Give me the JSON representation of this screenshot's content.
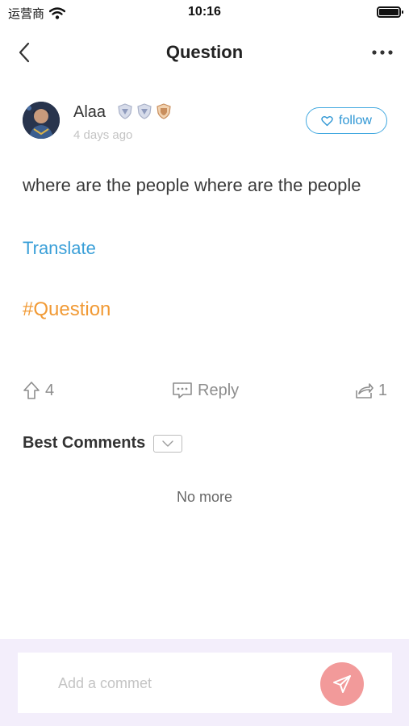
{
  "status_bar": {
    "carrier": "运营商",
    "time": "10:16"
  },
  "nav": {
    "title": "Question",
    "back_icon": "chevron-left-icon",
    "more_icon": "more-horizontal-icon"
  },
  "post": {
    "author": {
      "name": "Alaa",
      "time": "4 days ago",
      "badges": [
        "silver-shield-badge",
        "silver-shield-badge",
        "bronze-shield-badge"
      ]
    },
    "follow_label": "follow",
    "content": "where are the people where are the people",
    "translate_label": "Translate",
    "hashtag": "#Question",
    "actions": {
      "likes": "4",
      "reply_label": "Reply",
      "shares": "1"
    }
  },
  "comments": {
    "title": "Best Comments",
    "empty_text": "No more"
  },
  "comment_input": {
    "placeholder": "Add a commet"
  },
  "colors": {
    "accent_blue": "#3a9fd8",
    "hashtag_orange": "#f19a35",
    "send_button": "#f29a9a",
    "comment_bar_bg": "#f3eefb"
  }
}
